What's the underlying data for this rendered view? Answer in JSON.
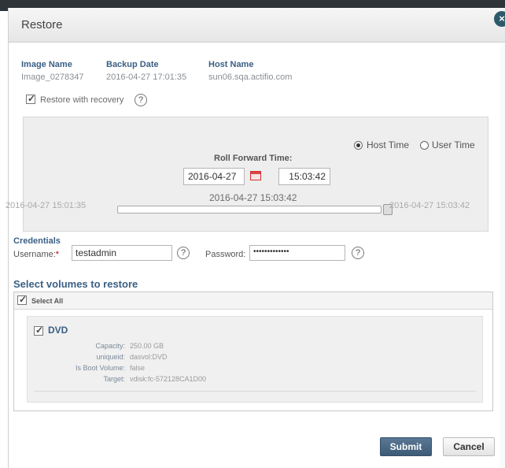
{
  "dialog": {
    "title": "Restore",
    "close_label": "×"
  },
  "info": {
    "image_name_label": "Image Name",
    "image_name_value": "Image_0278347",
    "backup_date_label": "Backup Date",
    "backup_date_value": "2016-04-27 17:01:35",
    "host_name_label": "Host Name",
    "host_name_value": "sun06.sqa.actifio.com"
  },
  "recovery": {
    "checkbox_label": "Restore with recovery",
    "help": "?"
  },
  "time": {
    "host_time_label": "Host Time",
    "user_time_label": "User Time",
    "roll_forward_label": "Roll Forward Time:",
    "date_value": "2016-04-27",
    "time_value": "15:03:42",
    "display_value": "2016-04-27 15:03:42",
    "range_start": "2016-04-27 15:01:35",
    "range_end": "2016-04-27 15:03:42",
    "slider_position": 1.0
  },
  "credentials": {
    "section_label": "Credentials",
    "username_label": "Username:",
    "required_marker": "*",
    "username_value": "testadmin",
    "password_label": "Password:",
    "password_value": "•••••••••••••",
    "help": "?"
  },
  "volumes": {
    "section_title": "Select volumes to restore",
    "select_all_label": "Select All",
    "items": [
      {
        "name": "DVD",
        "capacity_label": "Capacity:",
        "capacity_value": "250.00 GB",
        "uniqueid_label": "uniqueid:",
        "uniqueid_value": "dasvol:DVD",
        "boot_label": "Is Boot Volume:",
        "boot_value": "false",
        "target_label": "Target:",
        "target_value": "vdisk:fc-572128CA1D00"
      }
    ]
  },
  "buttons": {
    "submit": "Submit",
    "cancel": "Cancel"
  }
}
